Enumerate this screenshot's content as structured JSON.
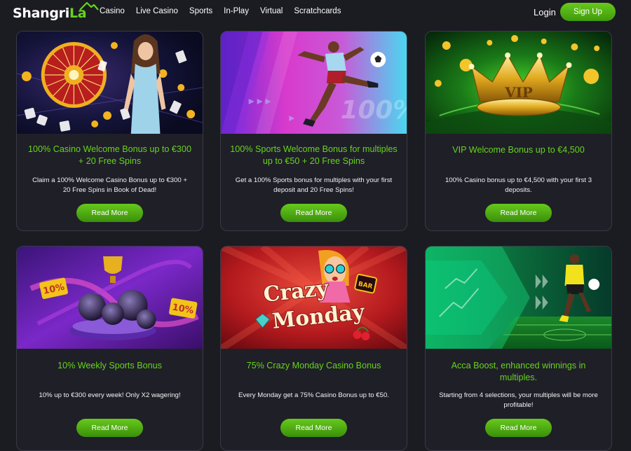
{
  "header": {
    "logo_part1": "Shangri",
    "logo_part2": "La",
    "nav": [
      "Casino",
      "Live Casino",
      "Sports",
      "In-Play",
      "Virtual",
      "Scratchcards"
    ],
    "login_label": "Login",
    "signup_label": "Sign Up"
  },
  "colors": {
    "background": "#1b1b22",
    "card_background": "#1f1f28",
    "accent_green": "#67d41c",
    "button_green": "#4faf12"
  },
  "cards": [
    {
      "title": "100% Casino Welcome Bonus up to €300 + 20 Free Spins",
      "description": "Claim a 100% Welcome Casino Bonus up to €300 + 20 Free Spins in Book of Dead!",
      "button_label": "Read More"
    },
    {
      "title": "100% Sports Welcome Bonus for multiples up to €50 + 20 Free Spins",
      "description": "Get a 100% Sports bonus for multiples with your first deposit and 20 Free Spins!",
      "button_label": "Read More",
      "banner_text": "100%"
    },
    {
      "title": "VIP Welcome Bonus up to €4,500",
      "description": "100% Casino bonus up to €4,500 with your first 3 deposits.",
      "button_label": "Read More",
      "banner_text": "VIP"
    },
    {
      "title": "10% Weekly Sports Bonus",
      "description": "10% up to €300 every week! Only X2 wagering!",
      "button_label": "Read More",
      "banner_text": "10%"
    },
    {
      "title": "75% Crazy Monday Casino Bonus",
      "description": "Every Monday get a 75% Casino Bonus up to €50.",
      "button_label": "Read More",
      "banner_text_1": "Crazy",
      "banner_text_2": "Monday",
      "banner_text_3": "BAR"
    },
    {
      "title": "Acca Boost, enhanced winnings in multiples.",
      "description": "Starting from 4 selections, your multiples will be more profitable!",
      "button_label": "Read More"
    }
  ]
}
